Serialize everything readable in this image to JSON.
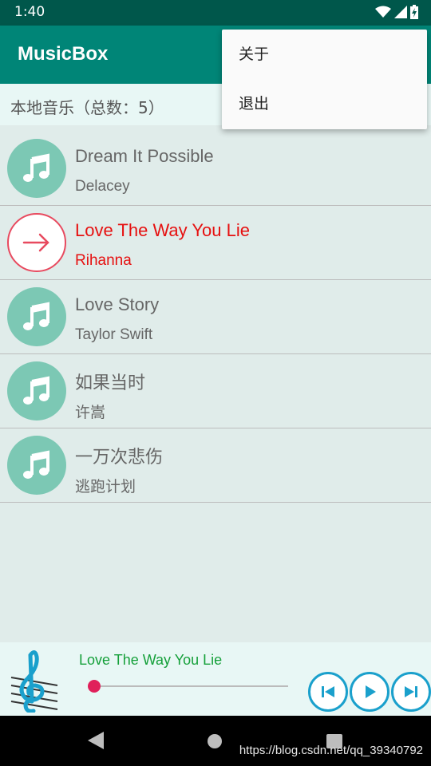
{
  "status": {
    "time": "1:40"
  },
  "app": {
    "title": "MusicBox"
  },
  "header": {
    "count_label": "本地音乐（总数：5）"
  },
  "menu": {
    "items": [
      {
        "label": "关于"
      },
      {
        "label": "退出"
      }
    ]
  },
  "songs": [
    {
      "title": "Dream It Possible",
      "artist": "Delacey",
      "icon": "music-note-icon"
    },
    {
      "title": "Love The Way You Lie",
      "artist": "Rihanna",
      "icon": "arrow-right-icon",
      "playing": true
    },
    {
      "title": "Love Story",
      "artist": "Taylor Swift",
      "icon": "music-note-icon"
    },
    {
      "title": "如果当时",
      "artist": "许嵩",
      "icon": "music-note-icon"
    },
    {
      "title": "一万次悲伤",
      "artist": "逃跑计划",
      "icon": "music-note-icon"
    }
  ],
  "player": {
    "current_title": "Love The Way You Lie",
    "progress": 0.0,
    "controls": [
      "previous-icon",
      "play-icon",
      "next-icon"
    ]
  },
  "watermark": "https://blog.csdn.net/qq_39340792",
  "colors": {
    "status_bar": "#00574b",
    "app_bar": "#008577",
    "playing_text": "#e61010",
    "player_title": "#15a03a",
    "control_ring": "#1aa0cc",
    "note_circle": "#7cc8b4"
  }
}
